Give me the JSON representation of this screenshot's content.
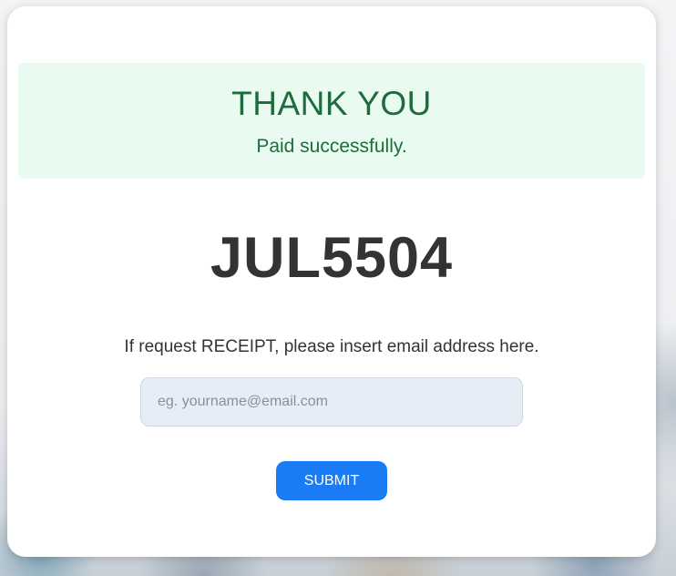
{
  "banner": {
    "title": "THANK YOU",
    "message": "Paid successfully."
  },
  "order": {
    "code": "JUL5504"
  },
  "receipt": {
    "prompt": "If request RECEIPT, please insert email address here.",
    "email_placeholder": "eg. yourname@email.com",
    "email_value": "",
    "submit_label": "SUBMIT"
  },
  "colors": {
    "banner_background": "#e9fbf0",
    "success_text": "#1e6b3d",
    "accent_button": "#1a7cf5",
    "input_background": "#e7edf6"
  }
}
